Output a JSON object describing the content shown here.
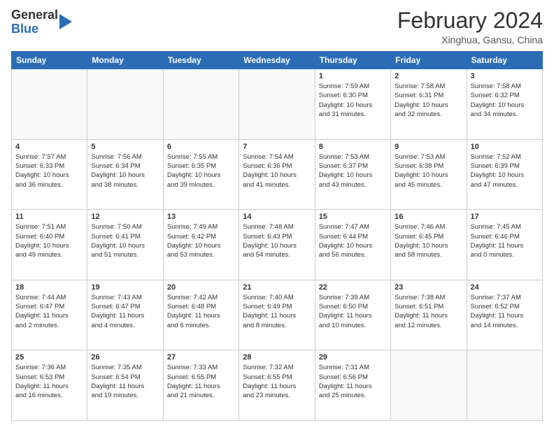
{
  "logo": {
    "general": "General",
    "blue": "Blue"
  },
  "header": {
    "month": "February 2024",
    "location": "Xinghua, Gansu, China"
  },
  "weekdays": [
    "Sunday",
    "Monday",
    "Tuesday",
    "Wednesday",
    "Thursday",
    "Friday",
    "Saturday"
  ],
  "weeks": [
    [
      {
        "day": "",
        "text": ""
      },
      {
        "day": "",
        "text": ""
      },
      {
        "day": "",
        "text": ""
      },
      {
        "day": "",
        "text": ""
      },
      {
        "day": "1",
        "text": "Sunrise: 7:59 AM\nSunset: 6:30 PM\nDaylight: 10 hours\nand 31 minutes."
      },
      {
        "day": "2",
        "text": "Sunrise: 7:58 AM\nSunset: 6:31 PM\nDaylight: 10 hours\nand 32 minutes."
      },
      {
        "day": "3",
        "text": "Sunrise: 7:58 AM\nSunset: 6:32 PM\nDaylight: 10 hours\nand 34 minutes."
      }
    ],
    [
      {
        "day": "4",
        "text": "Sunrise: 7:57 AM\nSunset: 6:33 PM\nDaylight: 10 hours\nand 36 minutes."
      },
      {
        "day": "5",
        "text": "Sunrise: 7:56 AM\nSunset: 6:34 PM\nDaylight: 10 hours\nand 38 minutes."
      },
      {
        "day": "6",
        "text": "Sunrise: 7:55 AM\nSunset: 6:35 PM\nDaylight: 10 hours\nand 39 minutes."
      },
      {
        "day": "7",
        "text": "Sunrise: 7:54 AM\nSunset: 6:36 PM\nDaylight: 10 hours\nand 41 minutes."
      },
      {
        "day": "8",
        "text": "Sunrise: 7:53 AM\nSunset: 6:37 PM\nDaylight: 10 hours\nand 43 minutes."
      },
      {
        "day": "9",
        "text": "Sunrise: 7:53 AM\nSunset: 6:38 PM\nDaylight: 10 hours\nand 45 minutes."
      },
      {
        "day": "10",
        "text": "Sunrise: 7:52 AM\nSunset: 6:39 PM\nDaylight: 10 hours\nand 47 minutes."
      }
    ],
    [
      {
        "day": "11",
        "text": "Sunrise: 7:51 AM\nSunset: 6:40 PM\nDaylight: 10 hours\nand 49 minutes."
      },
      {
        "day": "12",
        "text": "Sunrise: 7:50 AM\nSunset: 6:41 PM\nDaylight: 10 hours\nand 51 minutes."
      },
      {
        "day": "13",
        "text": "Sunrise: 7:49 AM\nSunset: 6:42 PM\nDaylight: 10 hours\nand 53 minutes."
      },
      {
        "day": "14",
        "text": "Sunrise: 7:48 AM\nSunset: 6:43 PM\nDaylight: 10 hours\nand 54 minutes."
      },
      {
        "day": "15",
        "text": "Sunrise: 7:47 AM\nSunset: 6:44 PM\nDaylight: 10 hours\nand 56 minutes."
      },
      {
        "day": "16",
        "text": "Sunrise: 7:46 AM\nSunset: 6:45 PM\nDaylight: 10 hours\nand 58 minutes."
      },
      {
        "day": "17",
        "text": "Sunrise: 7:45 AM\nSunset: 6:46 PM\nDaylight: 11 hours\nand 0 minutes."
      }
    ],
    [
      {
        "day": "18",
        "text": "Sunrise: 7:44 AM\nSunset: 6:47 PM\nDaylight: 11 hours\nand 2 minutes."
      },
      {
        "day": "19",
        "text": "Sunrise: 7:43 AM\nSunset: 6:47 PM\nDaylight: 11 hours\nand 4 minutes."
      },
      {
        "day": "20",
        "text": "Sunrise: 7:42 AM\nSunset: 6:48 PM\nDaylight: 11 hours\nand 6 minutes."
      },
      {
        "day": "21",
        "text": "Sunrise: 7:40 AM\nSunset: 6:49 PM\nDaylight: 11 hours\nand 8 minutes."
      },
      {
        "day": "22",
        "text": "Sunrise: 7:39 AM\nSunset: 6:50 PM\nDaylight: 11 hours\nand 10 minutes."
      },
      {
        "day": "23",
        "text": "Sunrise: 7:38 AM\nSunset: 6:51 PM\nDaylight: 11 hours\nand 12 minutes."
      },
      {
        "day": "24",
        "text": "Sunrise: 7:37 AM\nSunset: 6:52 PM\nDaylight: 11 hours\nand 14 minutes."
      }
    ],
    [
      {
        "day": "25",
        "text": "Sunrise: 7:36 AM\nSunset: 6:53 PM\nDaylight: 11 hours\nand 16 minutes."
      },
      {
        "day": "26",
        "text": "Sunrise: 7:35 AM\nSunset: 6:54 PM\nDaylight: 11 hours\nand 19 minutes."
      },
      {
        "day": "27",
        "text": "Sunrise: 7:33 AM\nSunset: 6:55 PM\nDaylight: 11 hours\nand 21 minutes."
      },
      {
        "day": "28",
        "text": "Sunrise: 7:32 AM\nSunset: 6:55 PM\nDaylight: 11 hours\nand 23 minutes."
      },
      {
        "day": "29",
        "text": "Sunrise: 7:31 AM\nSunset: 6:56 PM\nDaylight: 11 hours\nand 25 minutes."
      },
      {
        "day": "",
        "text": ""
      },
      {
        "day": "",
        "text": ""
      }
    ]
  ]
}
